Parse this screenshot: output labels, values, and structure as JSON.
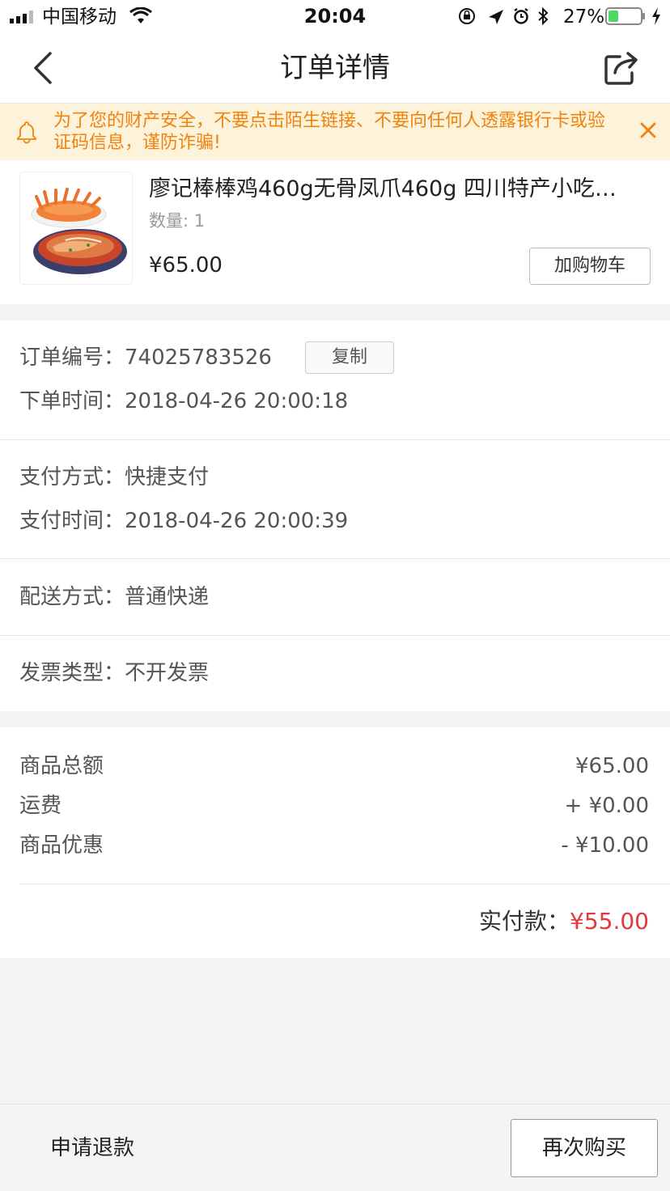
{
  "status_bar": {
    "carrier": "中国移动",
    "time": "20:04",
    "battery_percent": "27%",
    "icons": [
      "signal-icon",
      "wifi-icon",
      "rotation-lock-icon",
      "location-icon",
      "alarm-icon",
      "bluetooth-icon",
      "battery-icon",
      "charging-icon"
    ]
  },
  "nav": {
    "title": "订单详情",
    "back_icon": "chevron-left-icon",
    "share_icon": "share-icon"
  },
  "notice": {
    "text": "为了您的财产安全，不要点击陌生链接、不要向任何人透露银行卡或验证码信息，谨防诈骗!",
    "icon": "bell-icon",
    "close_icon": "close-icon",
    "color": "#f0830f"
  },
  "product": {
    "name": "廖记棒棒鸡460g无骨凤爪460g 四川特产小吃…",
    "quantity": "数量: 1",
    "price": "¥65.00",
    "add_cart_label": "加购物车"
  },
  "order_info": {
    "order_no_label": "订单编号：",
    "order_no": "74025783526",
    "copy_label": "复制",
    "order_time_label": "下单时间：",
    "order_time": "2018-04-26 20:00:18"
  },
  "payment": {
    "method_label": "支付方式：",
    "method": "快捷支付",
    "time_label": "支付时间：",
    "time": "2018-04-26 20:00:39"
  },
  "delivery": {
    "label": "配送方式：",
    "value": "普通快递"
  },
  "invoice": {
    "label": "发票类型：",
    "value": "不开发票"
  },
  "summary": {
    "items": [
      {
        "label": "商品总额",
        "value": "¥65.00"
      },
      {
        "label": "运费",
        "value": "+ ¥0.00"
      },
      {
        "label": "商品优惠",
        "value": "- ¥10.00"
      }
    ],
    "total_label": "实付款：",
    "total_value": "¥55.00",
    "total_color": "#e4393c"
  },
  "bottom": {
    "refund_label": "申请退款",
    "rebuy_label": "再次购买"
  }
}
